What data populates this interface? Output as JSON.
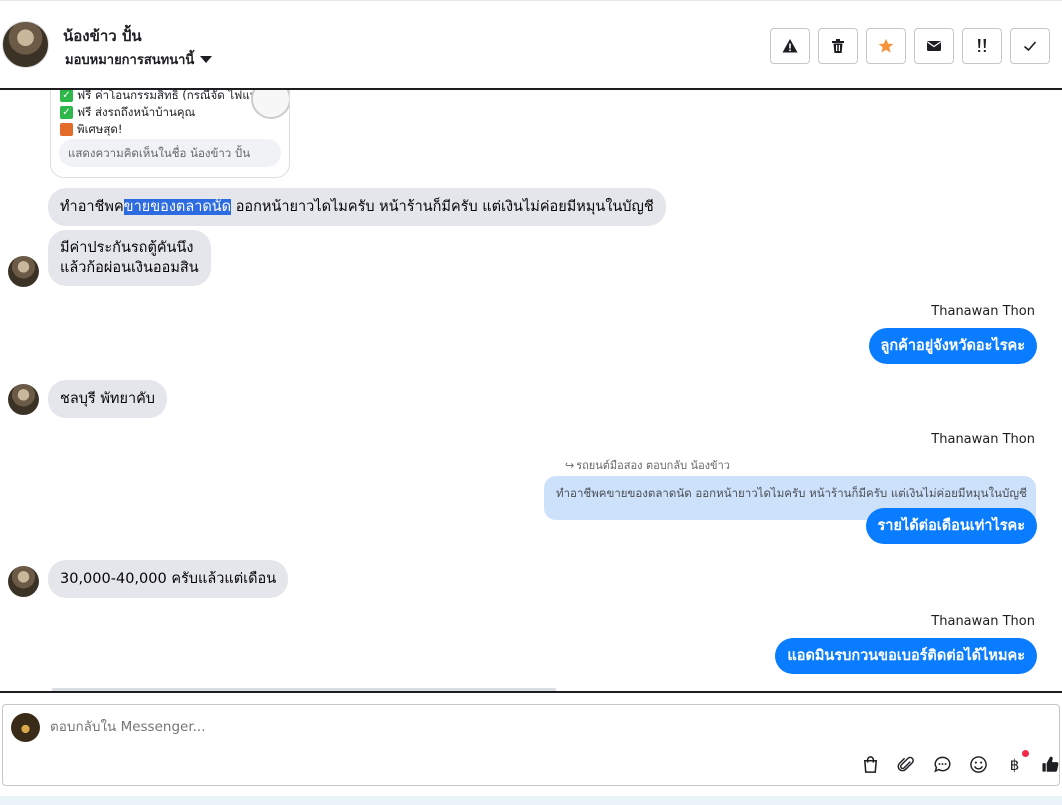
{
  "header": {
    "contact_name": "น้องข้าว ปั้น",
    "assign_label": "มอบหมายการสนทนานี้",
    "actions": [
      {
        "name": "report-spam-button",
        "icon": "warning-icon"
      },
      {
        "name": "delete-button",
        "icon": "trash-icon"
      },
      {
        "name": "star-button",
        "icon": "star-icon"
      },
      {
        "name": "mark-unread-button",
        "icon": "envelope-icon"
      },
      {
        "name": "follow-up-button",
        "icon": "flag-priority-icon"
      },
      {
        "name": "done-button",
        "icon": "check-icon"
      }
    ],
    "star_color": "#f7923b"
  },
  "post": {
    "line1": "ฟรี ค่าโอนกรรมสิทธิ์ (กรณีจัด ไฟแน",
    "line2": "ฟรี ส่งรถถึงหน้าบ้านคุณ",
    "line3": "พิเศษสุด!",
    "comment_placeholder": "แสดงความคิดเห็นในชื่อ น้องข้าว ปั้น"
  },
  "messages": {
    "m1_pre": "ทำอาชีพค",
    "m1_highlight": "ขายของตลาดนัด",
    "m1_post": " ออกหน้ายาวไดไมครับ  หน้าร้านก็มีครับ  แต่เงินไม่ค่อยมีหมุนในบัญชี",
    "m2_line1": "มีค่าประกันรถตู้คันนึง",
    "m2_line2": "แล้วก้อผ่อนเงินออมสิน",
    "sender_1": "Thanawan Thon",
    "m3": "ลูกค้าอยู่จังหวัดอะไรคะ",
    "m4": "ชลบุรี  พัทยาคับ",
    "sender_2": "Thanawan Thon",
    "reply_meta": "รถยนต์มือสอง ตอบกลับ น้องข้าว",
    "reply_quote": "ทำอาชีพคขายของตลาดนัด ออกหน้ายาวไดไมครับ หน้าร้านก็มีครับ แต่เงินไม่ค่อยมีหมุนในบัญชี",
    "m5": "รายได้ต่อเดือนเท่าไรคะ",
    "m6": "30,000-40,000 ครับแล้วแต่เดือน",
    "sender_3": "Thanawan Thon",
    "m7": "แอดมินรบกวนขอเบอร์ติดต่อได้ไหมคะ"
  },
  "composer": {
    "placeholder": "ตอบกลับใน Messenger...",
    "tools": [
      "shopping-bag-icon",
      "paperclip-icon",
      "saved-reply-icon",
      "emoji-icon",
      "baht-icon",
      "thumbs-up-icon"
    ],
    "baht_symbol": "฿"
  },
  "colors": {
    "outgoing": "#0a7cff",
    "incoming": "#e4e6eb",
    "highlight": "#2d6be0",
    "reply_quote_bg": "#cde1fb"
  }
}
